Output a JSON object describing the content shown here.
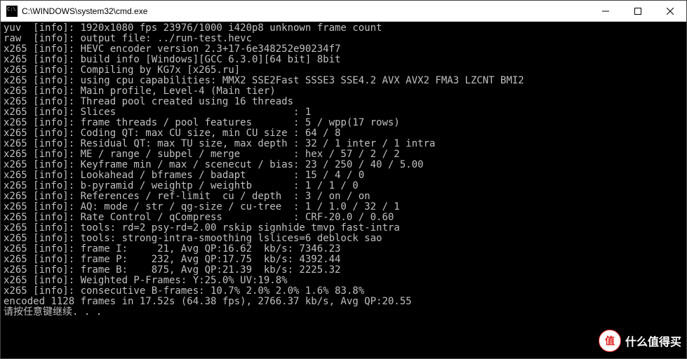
{
  "window": {
    "title": "C:\\WINDOWS\\system32\\cmd.exe"
  },
  "lines": [
    "yuv  [info]: 1920x1080 fps 23976/1000 i420p8 unknown frame count",
    "raw  [info]: output file: ../run-test.hevc",
    "x265 [info]: HEVC encoder version 2.3+17-6e348252e90234f7",
    "x265 [info]: build info [Windows][GCC 6.3.0][64 bit] 8bit",
    "x265 [info]: Compiling by KG7x [x265.ru]",
    "x265 [info]: using cpu capabilities: MMX2 SSE2Fast SSSE3 SSE4.2 AVX AVX2 FMA3 LZCNT BMI2",
    "x265 [info]: Main profile, Level-4 (Main tier)",
    "x265 [info]: Thread pool created using 16 threads",
    "x265 [info]: Slices                              : 1",
    "x265 [info]: frame threads / pool features       : 5 / wpp(17 rows)",
    "x265 [info]: Coding QT: max CU size, min CU size : 64 / 8",
    "x265 [info]: Residual QT: max TU size, max depth : 32 / 1 inter / 1 intra",
    "x265 [info]: ME / range / subpel / merge         : hex / 57 / 2 / 2",
    "x265 [info]: Keyframe min / max / scenecut / bias: 23 / 250 / 40 / 5.00",
    "x265 [info]: Lookahead / bframes / badapt        : 15 / 4 / 0",
    "x265 [info]: b-pyramid / weightp / weightb       : 1 / 1 / 0",
    "x265 [info]: References / ref-limit  cu / depth  : 3 / on / on",
    "x265 [info]: AQ: mode / str / qg-size / cu-tree  : 1 / 1.0 / 32 / 1",
    "x265 [info]: Rate Control / qCompress            : CRF-20.0 / 0.60",
    "x265 [info]: tools: rd=2 psy-rd=2.00 rskip signhide tmvp fast-intra",
    "x265 [info]: tools: strong-intra-smoothing lslices=6 deblock sao",
    "x265 [info]: frame I:     21, Avg QP:16.62  kb/s: 7346.23",
    "x265 [info]: frame P:    232, Avg QP:17.75  kb/s: 4392.44",
    "x265 [info]: frame B:    875, Avg QP:21.39  kb/s: 2225.32",
    "x265 [info]: Weighted P-Frames: Y:25.0% UV:19.8%",
    "x265 [info]: consecutive B-frames: 10.7% 2.0% 2.0% 1.6% 83.8%",
    "",
    "encoded 1128 frames in 17.52s (64.38 fps), 2766.37 kb/s, Avg QP:20.55",
    "请按任意键继续. . ."
  ],
  "watermark": {
    "badge": "值",
    "text": "什么值得买"
  }
}
